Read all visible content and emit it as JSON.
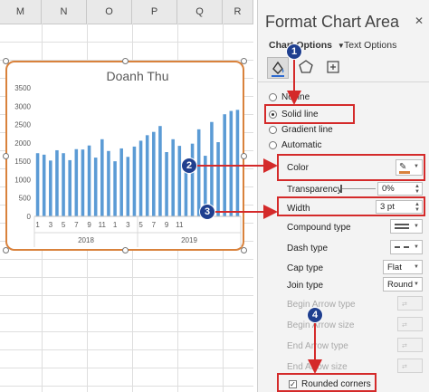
{
  "sheet": {
    "columns": [
      "M",
      "N",
      "O",
      "P",
      "Q",
      "R"
    ]
  },
  "chart_data": {
    "type": "bar",
    "title": "Doanh Thu",
    "ylim": [
      0,
      3500
    ],
    "yticks": [
      "0",
      "500",
      "1000",
      "1500",
      "2000",
      "2500",
      "3000",
      "3500"
    ],
    "xticks": [
      "1",
      "3",
      "5",
      "7",
      "9",
      "11",
      "1",
      "3",
      "5",
      "7",
      "9",
      "11"
    ],
    "groups": [
      "2018",
      "2019"
    ],
    "values": [
      1720,
      1680,
      1520,
      1800,
      1720,
      1530,
      1830,
      1820,
      1930,
      1600,
      2100,
      1780,
      1500,
      1850,
      1620,
      1900,
      2060,
      2210,
      2300,
      2460,
      1750,
      2100,
      1920,
      1540,
      1980,
      2370,
      1650,
      2570,
      2020,
      2780,
      2870,
      2900
    ],
    "bar_color": "#5b9bd5",
    "grid": false
  },
  "pane": {
    "title": "Format Chart Area",
    "close": "✕",
    "tabs": {
      "chart_options": "Chart Options",
      "text_options": "Text Options"
    },
    "line_options": {
      "no_line": "No line",
      "solid_line": "Solid line",
      "gradient_line": "Gradient line",
      "automatic": "Automatic"
    },
    "properties": {
      "color": "Color",
      "transparency": "Transparency",
      "transparency_value": "0%",
      "width": "Width",
      "width_value": "3 pt",
      "compound_type": "Compound type",
      "dash_type": "Dash type",
      "cap_type": "Cap type",
      "cap_value": "Flat",
      "join_type": "Join type",
      "join_value": "Round",
      "begin_arrow_type": "Begin Arrow type",
      "begin_arrow_size": "Begin Arrow size",
      "end_arrow_type": "End Arrow type",
      "end_arrow_size": "End Arrow size",
      "rounded_corners": "Rounded corners"
    }
  },
  "annotations": {
    "b1": "1",
    "b2": "2",
    "b3": "3",
    "b4": "4",
    "color": "#d42a2a",
    "badge_color": "#1f3f8f"
  },
  "icons": [
    "fill-line-icon",
    "pentagon-effects-icon",
    "size-properties-icon",
    "chevron-down-icon",
    "color-picker-icon",
    "compound-line-icon",
    "dash-line-icon"
  ]
}
